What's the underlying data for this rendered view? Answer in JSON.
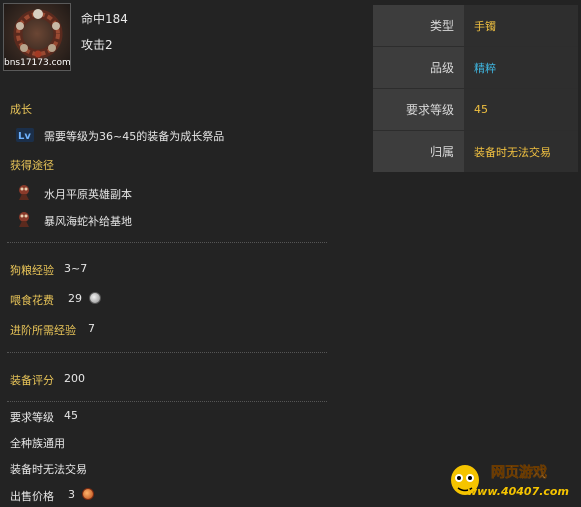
{
  "item": {
    "watermark": "bns17173.com",
    "stats": [
      "命中184",
      "攻击2"
    ]
  },
  "info_table": [
    {
      "key": "类型",
      "value": "手镯",
      "color": "#f0c040"
    },
    {
      "key": "品级",
      "value": "精粹",
      "color": "#3fb6e0"
    },
    {
      "key": "要求等级",
      "value": "45",
      "color": "#f0c040"
    },
    {
      "key": "归属",
      "value": "装备时无法交易",
      "color": "#f0c040"
    }
  ],
  "growth": {
    "title": "成长",
    "icon": "level-badge-icon",
    "text": "需要等级为36~45的装备为成长祭品"
  },
  "source": {
    "title": "获得途径",
    "items": [
      {
        "icon": "dungeon-monster-icon",
        "text": "水月平原英雄副本"
      },
      {
        "icon": "dungeon-monster-icon",
        "text": "暴风海蛇补给基地"
      }
    ]
  },
  "pet": {
    "food_exp_label": "狗粮经验",
    "food_exp_value": "3~7",
    "feed_cost_label": "喂食花费",
    "feed_cost_value": "29",
    "advance_exp_label": "进阶所需经验",
    "advance_exp_value": "7"
  },
  "score": {
    "label": "装备评分",
    "value": "200"
  },
  "requirements": {
    "level_label": "要求等级",
    "level_value": "45",
    "race": "全种族通用",
    "bind": "装备时无法交易",
    "price_label": "出售价格",
    "price_value": "3"
  },
  "brand": {
    "line1": "网页游戏",
    "line2": "www.40407.com"
  }
}
